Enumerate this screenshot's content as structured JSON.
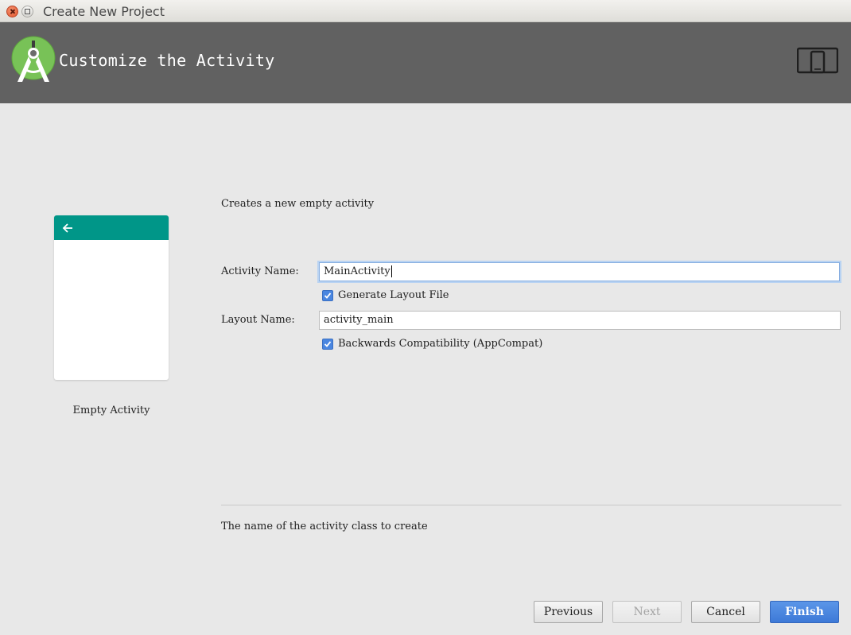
{
  "window": {
    "title": "Create New Project"
  },
  "header": {
    "title": "Customize the Activity",
    "logo_icon": "android-studio-logo-icon",
    "device_icon": "phone-tablet-icon"
  },
  "preview": {
    "label": "Empty Activity",
    "bar_color": "#009688",
    "back_icon": "back-arrow-icon"
  },
  "form": {
    "description": "Creates a new empty activity",
    "activity_name": {
      "label": "Activity Name:",
      "value": "MainActivity"
    },
    "generate_layout": {
      "label": "Generate Layout File",
      "checked": true
    },
    "layout_name": {
      "label": "Layout Name:",
      "value": "activity_main"
    },
    "backwards_compat": {
      "label": "Backwards Compatibility (AppCompat)",
      "checked": true
    },
    "help_text": "The name of the activity class to create"
  },
  "buttons": {
    "previous": "Previous",
    "next": "Next",
    "cancel": "Cancel",
    "finish": "Finish"
  },
  "colors": {
    "header_bg": "#616161",
    "accent": "#4a86e0"
  }
}
